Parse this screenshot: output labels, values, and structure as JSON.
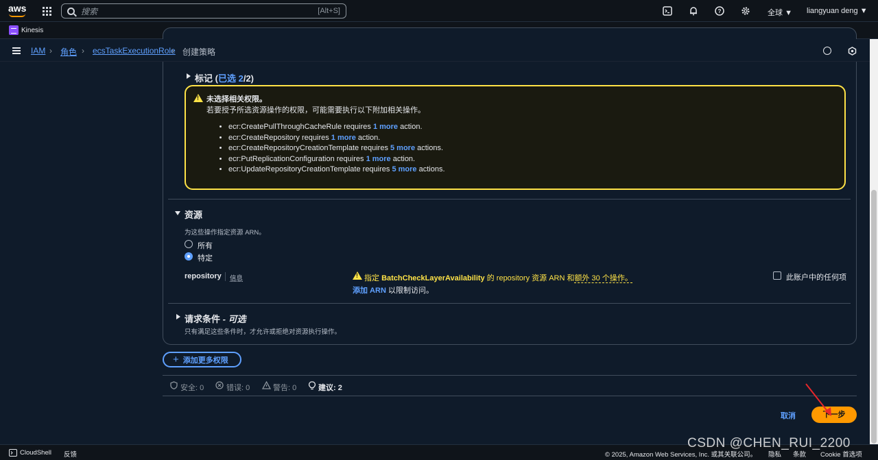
{
  "topnav": {
    "logo_text": "aws",
    "search_placeholder": "搜索",
    "search_shortcut": "[Alt+S]",
    "region": "全球",
    "user": "liangyuan deng"
  },
  "service_bar": {
    "service": "Kinesis"
  },
  "breadcrumb": {
    "items": [
      "IAM",
      "角色",
      "ecsTaskExecutionRole"
    ],
    "current": "创建策略"
  },
  "tags_section": {
    "label": "标记",
    "prefix": "(",
    "selected_text": "已选 2",
    "suffix": "/2)"
  },
  "warning": {
    "title": "未选择相关权限。",
    "subtitle": "若要授予所选资源操作的权限，可能需要执行以下附加相关操作。",
    "items": [
      {
        "text": "ecr:CreatePullThroughCacheRule requires ",
        "more": "1 more",
        "tail": " action."
      },
      {
        "text": "ecr:CreateRepository requires ",
        "more": "1 more",
        "tail": " action."
      },
      {
        "text": "ecr:CreateRepositoryCreationTemplate requires ",
        "more": "5 more",
        "tail": " actions."
      },
      {
        "text": "ecr:PutReplicationConfiguration requires ",
        "more": "1 more",
        "tail": " action."
      },
      {
        "text": "ecr:UpdateRepositoryCreationTemplate requires ",
        "more": "5 more",
        "tail": " actions."
      }
    ]
  },
  "resources": {
    "title": "资源",
    "description": "为这些操作指定资源 ARN。",
    "options": [
      "所有",
      "特定"
    ],
    "selected": "特定",
    "repository_label": "repository",
    "info_link": "信息",
    "arn_warning_prefix": "指定 ",
    "arn_warning_action": "BatchCheckLayerAvailability",
    "arn_warning_mid": " 的 repository 资源 ARN 和",
    "arn_warning_extra": "额外 30 个操作。",
    "add_arn": "添加 ARN",
    "add_arn_tail": " 以限制访问。",
    "any_in_account": "此账户中的任何项"
  },
  "conditions": {
    "title": "请求条件",
    "optional": " - 可选",
    "description": "只有满足这些条件时，才允许或拒绝对资源执行操作。"
  },
  "add_more_button": "添加更多权限",
  "status": {
    "security": "安全: 0",
    "errors": "错误: 0",
    "warnings": "警告: 0",
    "suggestions": "建议: 2"
  },
  "actions": {
    "cancel": "取消",
    "next": "下一步"
  },
  "footer": {
    "cloudshell": "CloudShell",
    "feedback": "反馈",
    "copyright": "© 2025, Amazon Web Services, Inc. 或其关联公司。",
    "privacy": "隐私",
    "terms": "条款",
    "cookie": "Cookie 首选项"
  },
  "watermark": "CSDN @CHEN_RUI_2200",
  "colors": {
    "accent_blue": "#5fa0ff",
    "primary_orange": "#ff9900",
    "warning_yellow": "#ffe347"
  }
}
